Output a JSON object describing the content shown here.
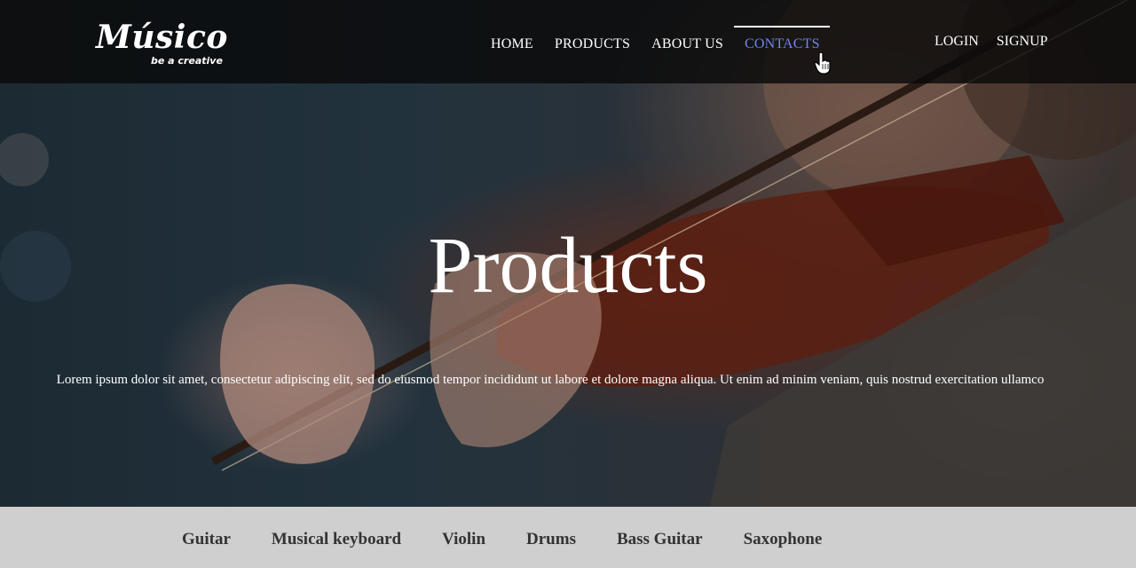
{
  "logo": {
    "name": "Músico",
    "tagline": "be a creative"
  },
  "nav": {
    "items": [
      "HOME",
      "PRODUCTS",
      "ABOUT US",
      "CONTACTS"
    ],
    "active": "CONTACTS",
    "active_color": "#6e86f0"
  },
  "auth": {
    "login": "LOGIN",
    "signup": "SIGNUP"
  },
  "hero": {
    "title": "Products",
    "text": "Lorem ipsum dolor sit amet, consectetur adipiscing elit, sed do eiusmod tempor incididunt ut labore et dolore magna aliqua. Ut enim ad minim veniam, quis nostrud exercitation ullamco",
    "image": "violinist-photo"
  },
  "categories": [
    "Guitar",
    "Musical keyboard",
    "Violin",
    "Drums",
    "Bass Guitar",
    "Saxophone"
  ],
  "colors": {
    "navbar_bg": "#0a0a0a",
    "category_bar_bg": "#cfcfcf",
    "category_text": "#333333"
  }
}
